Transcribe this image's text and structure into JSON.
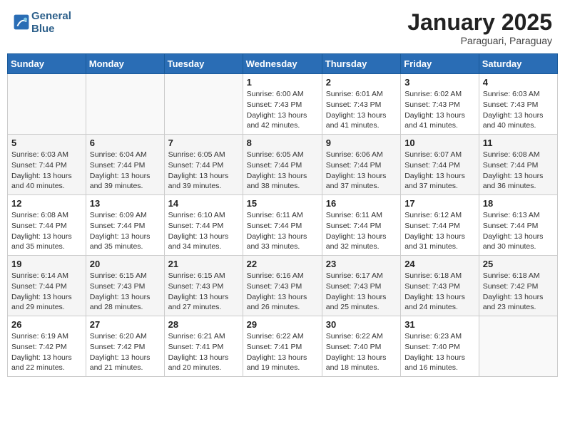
{
  "header": {
    "logo_line1": "General",
    "logo_line2": "Blue",
    "month": "January 2025",
    "location": "Paraguari, Paraguay"
  },
  "weekdays": [
    "Sunday",
    "Monday",
    "Tuesday",
    "Wednesday",
    "Thursday",
    "Friday",
    "Saturday"
  ],
  "weeks": [
    [
      {
        "day": "",
        "info": ""
      },
      {
        "day": "",
        "info": ""
      },
      {
        "day": "",
        "info": ""
      },
      {
        "day": "1",
        "info": "Sunrise: 6:00 AM\nSunset: 7:43 PM\nDaylight: 13 hours\nand 42 minutes."
      },
      {
        "day": "2",
        "info": "Sunrise: 6:01 AM\nSunset: 7:43 PM\nDaylight: 13 hours\nand 41 minutes."
      },
      {
        "day": "3",
        "info": "Sunrise: 6:02 AM\nSunset: 7:43 PM\nDaylight: 13 hours\nand 41 minutes."
      },
      {
        "day": "4",
        "info": "Sunrise: 6:03 AM\nSunset: 7:43 PM\nDaylight: 13 hours\nand 40 minutes."
      }
    ],
    [
      {
        "day": "5",
        "info": "Sunrise: 6:03 AM\nSunset: 7:44 PM\nDaylight: 13 hours\nand 40 minutes."
      },
      {
        "day": "6",
        "info": "Sunrise: 6:04 AM\nSunset: 7:44 PM\nDaylight: 13 hours\nand 39 minutes."
      },
      {
        "day": "7",
        "info": "Sunrise: 6:05 AM\nSunset: 7:44 PM\nDaylight: 13 hours\nand 39 minutes."
      },
      {
        "day": "8",
        "info": "Sunrise: 6:05 AM\nSunset: 7:44 PM\nDaylight: 13 hours\nand 38 minutes."
      },
      {
        "day": "9",
        "info": "Sunrise: 6:06 AM\nSunset: 7:44 PM\nDaylight: 13 hours\nand 37 minutes."
      },
      {
        "day": "10",
        "info": "Sunrise: 6:07 AM\nSunset: 7:44 PM\nDaylight: 13 hours\nand 37 minutes."
      },
      {
        "day": "11",
        "info": "Sunrise: 6:08 AM\nSunset: 7:44 PM\nDaylight: 13 hours\nand 36 minutes."
      }
    ],
    [
      {
        "day": "12",
        "info": "Sunrise: 6:08 AM\nSunset: 7:44 PM\nDaylight: 13 hours\nand 35 minutes."
      },
      {
        "day": "13",
        "info": "Sunrise: 6:09 AM\nSunset: 7:44 PM\nDaylight: 13 hours\nand 35 minutes."
      },
      {
        "day": "14",
        "info": "Sunrise: 6:10 AM\nSunset: 7:44 PM\nDaylight: 13 hours\nand 34 minutes."
      },
      {
        "day": "15",
        "info": "Sunrise: 6:11 AM\nSunset: 7:44 PM\nDaylight: 13 hours\nand 33 minutes."
      },
      {
        "day": "16",
        "info": "Sunrise: 6:11 AM\nSunset: 7:44 PM\nDaylight: 13 hours\nand 32 minutes."
      },
      {
        "day": "17",
        "info": "Sunrise: 6:12 AM\nSunset: 7:44 PM\nDaylight: 13 hours\nand 31 minutes."
      },
      {
        "day": "18",
        "info": "Sunrise: 6:13 AM\nSunset: 7:44 PM\nDaylight: 13 hours\nand 30 minutes."
      }
    ],
    [
      {
        "day": "19",
        "info": "Sunrise: 6:14 AM\nSunset: 7:44 PM\nDaylight: 13 hours\nand 29 minutes."
      },
      {
        "day": "20",
        "info": "Sunrise: 6:15 AM\nSunset: 7:43 PM\nDaylight: 13 hours\nand 28 minutes."
      },
      {
        "day": "21",
        "info": "Sunrise: 6:15 AM\nSunset: 7:43 PM\nDaylight: 13 hours\nand 27 minutes."
      },
      {
        "day": "22",
        "info": "Sunrise: 6:16 AM\nSunset: 7:43 PM\nDaylight: 13 hours\nand 26 minutes."
      },
      {
        "day": "23",
        "info": "Sunrise: 6:17 AM\nSunset: 7:43 PM\nDaylight: 13 hours\nand 25 minutes."
      },
      {
        "day": "24",
        "info": "Sunrise: 6:18 AM\nSunset: 7:43 PM\nDaylight: 13 hours\nand 24 minutes."
      },
      {
        "day": "25",
        "info": "Sunrise: 6:18 AM\nSunset: 7:42 PM\nDaylight: 13 hours\nand 23 minutes."
      }
    ],
    [
      {
        "day": "26",
        "info": "Sunrise: 6:19 AM\nSunset: 7:42 PM\nDaylight: 13 hours\nand 22 minutes."
      },
      {
        "day": "27",
        "info": "Sunrise: 6:20 AM\nSunset: 7:42 PM\nDaylight: 13 hours\nand 21 minutes."
      },
      {
        "day": "28",
        "info": "Sunrise: 6:21 AM\nSunset: 7:41 PM\nDaylight: 13 hours\nand 20 minutes."
      },
      {
        "day": "29",
        "info": "Sunrise: 6:22 AM\nSunset: 7:41 PM\nDaylight: 13 hours\nand 19 minutes."
      },
      {
        "day": "30",
        "info": "Sunrise: 6:22 AM\nSunset: 7:40 PM\nDaylight: 13 hours\nand 18 minutes."
      },
      {
        "day": "31",
        "info": "Sunrise: 6:23 AM\nSunset: 7:40 PM\nDaylight: 13 hours\nand 16 minutes."
      },
      {
        "day": "",
        "info": ""
      }
    ]
  ]
}
